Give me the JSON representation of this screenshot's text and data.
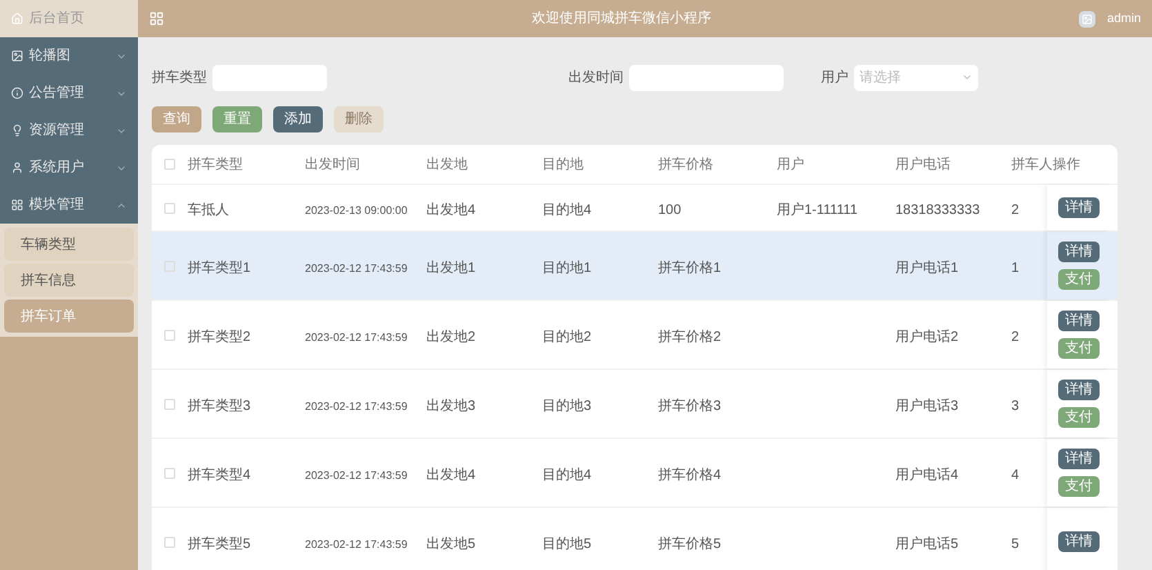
{
  "sidebar": {
    "home": "后台首页",
    "menus": [
      {
        "label": "轮播图",
        "expanded": false
      },
      {
        "label": "公告管理",
        "expanded": false
      },
      {
        "label": "资源管理",
        "expanded": false
      },
      {
        "label": "系统用户",
        "expanded": false
      },
      {
        "label": "模块管理",
        "expanded": true,
        "children": [
          {
            "label": "车辆类型",
            "selected": false
          },
          {
            "label": "拼车信息",
            "selected": false
          },
          {
            "label": "拼车订单",
            "selected": true
          }
        ]
      }
    ]
  },
  "topbar": {
    "title": "欢迎使用同城拼车微信小程序",
    "user": "admin"
  },
  "search": {
    "fields": [
      {
        "label": "拼车类型",
        "kind": "text"
      },
      {
        "label": "出发时间",
        "kind": "text"
      },
      {
        "label": "用户",
        "kind": "select",
        "placeholder": "请选择"
      }
    ],
    "buttons": [
      {
        "label": "查询",
        "disabled": false
      },
      {
        "label": "重置",
        "disabled": false
      },
      {
        "label": "添加",
        "disabled": false
      },
      {
        "label": "删除",
        "disabled": true
      }
    ]
  },
  "table": {
    "all_checked": false,
    "columns": [
      "拼车类型",
      "出发时间",
      "出发地",
      "目的地",
      "拼车价格",
      "用户",
      "用户电话",
      "拼车人",
      "操作"
    ],
    "rows": [
      {
        "cells": [
          "车抵人",
          "2023-02-13 09:00:00",
          "出发地4",
          "目的地4",
          "100",
          "用户1-111111",
          "18318333333",
          "2"
        ],
        "checked": false,
        "highlighted": false,
        "actions": [
          "详情"
        ]
      },
      {
        "cells": [
          "拼车类型1",
          "2023-02-12 17:43:59",
          "出发地1",
          "目的地1",
          "拼车价格1",
          "",
          "用户电话1",
          "1"
        ],
        "checked": false,
        "highlighted": true,
        "actions": [
          "详情",
          "支付"
        ]
      },
      {
        "cells": [
          "拼车类型2",
          "2023-02-12 17:43:59",
          "出发地2",
          "目的地2",
          "拼车价格2",
          "",
          "用户电话2",
          "2"
        ],
        "checked": false,
        "highlighted": false,
        "actions": [
          "详情",
          "支付"
        ]
      },
      {
        "cells": [
          "拼车类型3",
          "2023-02-12 17:43:59",
          "出发地3",
          "目的地3",
          "拼车价格3",
          "",
          "用户电话3",
          "3"
        ],
        "checked": false,
        "highlighted": false,
        "actions": [
          "详情",
          "支付"
        ]
      },
      {
        "cells": [
          "拼车类型4",
          "2023-02-12 17:43:59",
          "出发地4",
          "目的地4",
          "拼车价格4",
          "",
          "用户电话4",
          "4"
        ],
        "checked": false,
        "highlighted": false,
        "actions": [
          "详情",
          "支付"
        ]
      },
      {
        "cells": [
          "拼车类型5",
          "2023-02-12 17:43:59",
          "出发地5",
          "目的地5",
          "拼车价格5",
          "",
          "用户电话5",
          "5"
        ],
        "checked": false,
        "highlighted": false,
        "actions": [
          "详情"
        ]
      }
    ]
  }
}
